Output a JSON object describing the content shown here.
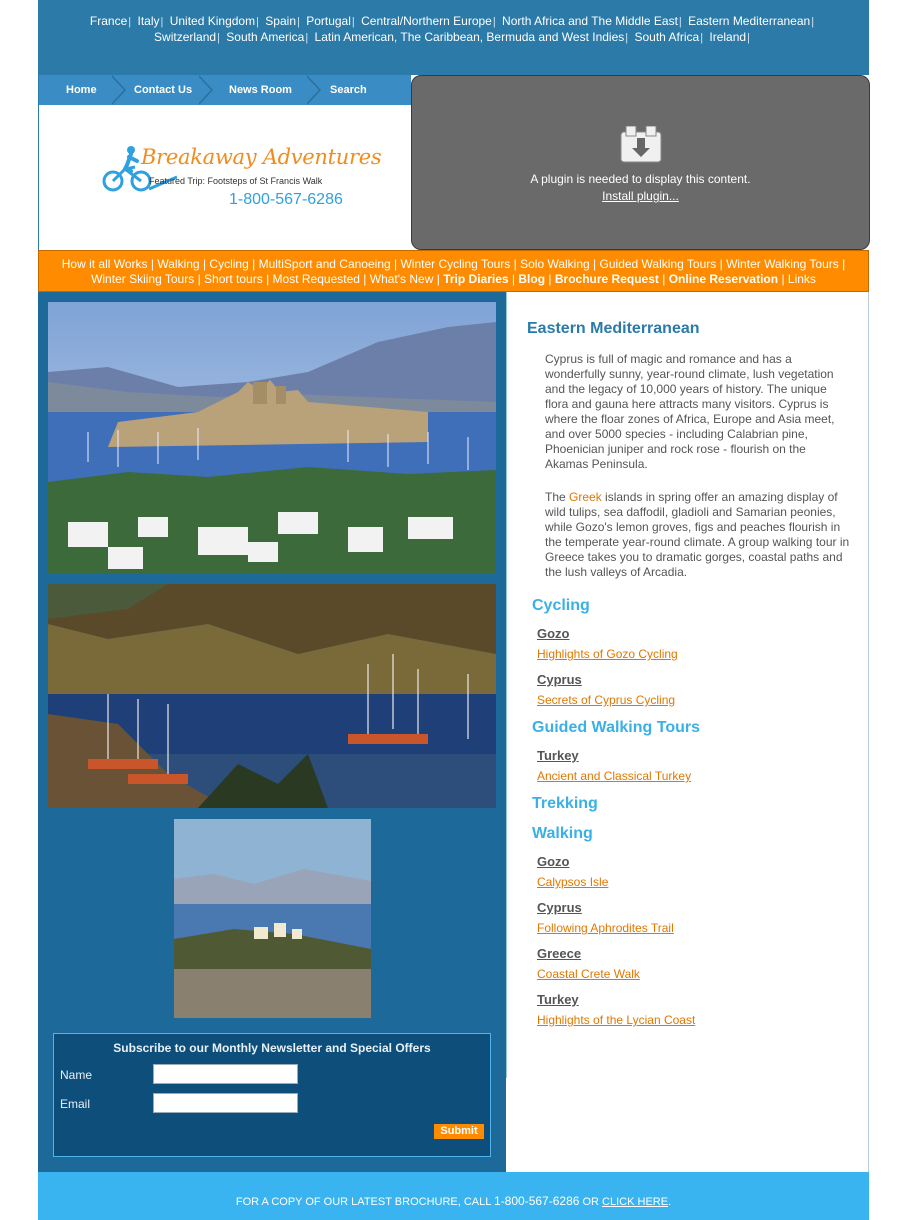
{
  "countries": [
    "France",
    "Italy",
    "United Kingdom",
    "Spain",
    "Portugal",
    "Central/Northern Europe",
    "North Africa and The Middle East",
    "Eastern Mediterranean",
    "Switzerland",
    "South America",
    "Latin American, The Caribbean, Bermuda and West Indies",
    "South Africa",
    "Ireland"
  ],
  "country_separator": "|",
  "nav": [
    "Home",
    "Contact Us",
    "News Room",
    "Search"
  ],
  "logo": {
    "name": "Breakaway Adventures",
    "featured": "Featured Trip: Footsteps of St Francis Walk",
    "phone": "1-800-567-6286"
  },
  "plugin": {
    "message": "A plugin is needed to display this content.",
    "install": "Install plugin..."
  },
  "menu": [
    {
      "label": "How it all Works",
      "bold": false
    },
    {
      "label": "Walking",
      "bold": false
    },
    {
      "label": "Cycling",
      "bold": false
    },
    {
      "label": "MultiSport and Canoeing",
      "bold": false
    },
    {
      "label": "Winter Cycling Tours",
      "bold": false
    },
    {
      "label": "Solo Walking",
      "bold": false
    },
    {
      "label": "Guided Walking Tours",
      "bold": false
    },
    {
      "label": "Winter Walking Tours",
      "bold": false
    },
    {
      "label": "Winter Skiing Tours",
      "bold": false
    },
    {
      "label": "Short tours",
      "bold": false
    },
    {
      "label": "Most Requested",
      "bold": false
    },
    {
      "label": "What's New",
      "bold": false
    },
    {
      "label": "Trip Diaries",
      "bold": true
    },
    {
      "label": "Blog",
      "bold": true
    },
    {
      "label": "Brochure Request",
      "bold": true
    },
    {
      "label": "Online Reservation",
      "bold": true
    },
    {
      "label": "Links",
      "bold": false
    }
  ],
  "newsletter": {
    "title": "Subscribe to our Monthly Newsletter and Special Offers",
    "name_label": "Name",
    "email_label": "Email",
    "name_value": "",
    "email_value": "",
    "submit": "Submit"
  },
  "content": {
    "region_title": "Eastern Mediterranean",
    "para1": "Cyprus is full of magic and romance and has a wonderfully sunny, year-round climate, lush vegetation and the legacy of 10,000 years of history.   The unique flora and gauna here attracts many visitors.  Cyprus is where the floar zones of Africa, Europe and Asia meet, and over 5000 species - including Calabrian pine, Phoenician juniper and rock rose - flourish on the Akamas Peninsula.",
    "para2_before": "The ",
    "para2_link": "Greek",
    "para2_after": " islands in spring offer an amazing display of wild tulips, sea daffodil, gladioli and Samarian peonies, while Gozo's lemon groves, figs and peaches flourish in the temperate year-round climate.  A group walking tour in Greece takes you to dramatic gorges, coastal paths and the lush valleys of Arcadia.",
    "sections": {
      "cycling": "Cycling",
      "guided": "Guided Walking Tours",
      "trekking": "Trekking",
      "walking": "Walking"
    },
    "destinations": {
      "c_gozo": "Gozo",
      "c_gozo_trip": "Highlights of Gozo Cycling",
      "c_cyprus": "Cyprus",
      "c_cyprus_trip": "Secrets of Cyprus Cycling",
      "g_turkey": "Turkey",
      "g_turkey_trip": "Ancient and Classical Turkey",
      "w_gozo": "Gozo",
      "w_gozo_trip": "Calypsos Isle",
      "w_cyprus": "Cyprus",
      "w_cyprus_trip": "Following Aphrodites Trail",
      "w_greece": "Greece",
      "w_greece_trip": "Coastal Crete Walk",
      "w_turkey": "Turkey",
      "w_turkey_trip": "Highlights of the Lycian Coast"
    }
  },
  "footer": {
    "text_before": "FOR A COPY OF OUR LATEST BROCHURE, CALL ",
    "phone": "1-800-567-6286",
    "text_or": " OR ",
    "link": "CLICK HERE",
    "end": "."
  },
  "colors": {
    "top_bar": "#2b7aa8",
    "menu_orange": "#ff8c00",
    "left_column": "#1d6a9a",
    "footer": "#3ab4f0",
    "link_orange": "#e07800",
    "section_blue": "#3ab0e6"
  }
}
